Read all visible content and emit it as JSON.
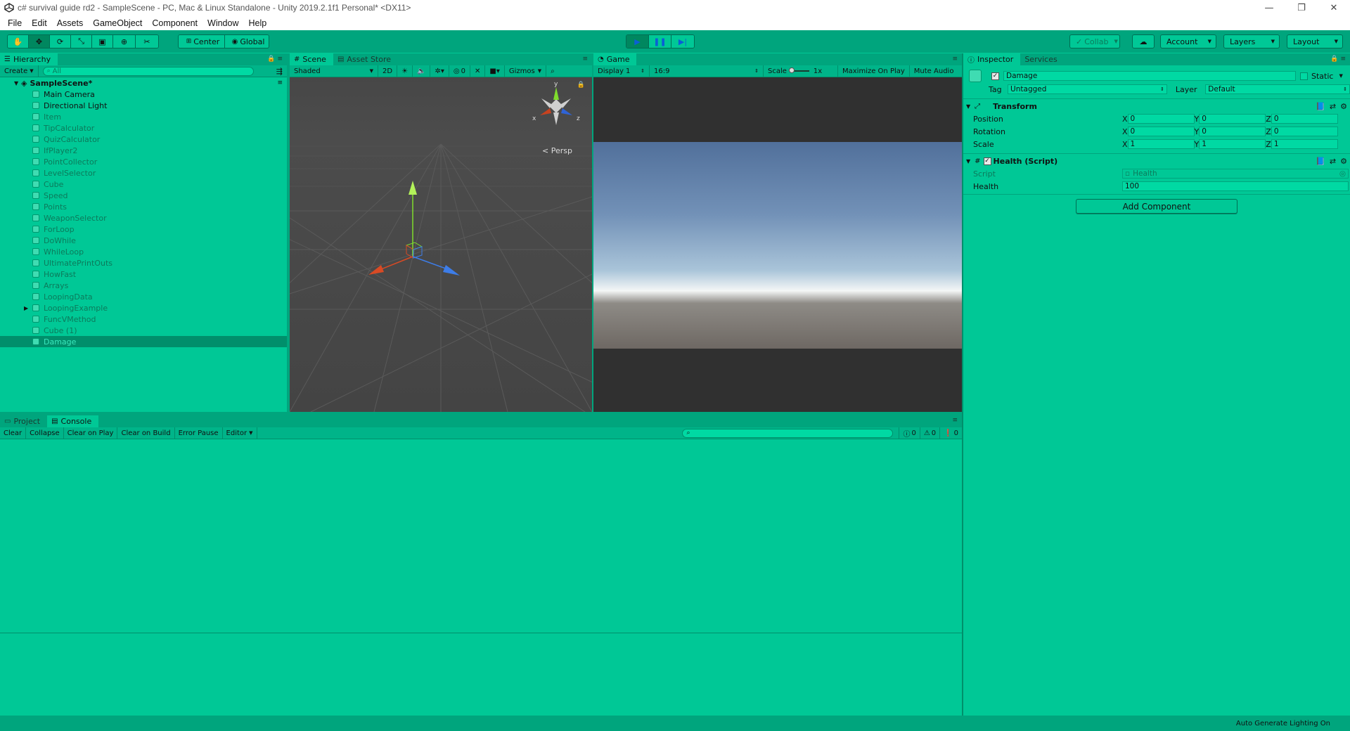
{
  "window": {
    "title": "c# survival guide rd2 - SampleScene - PC, Mac & Linux Standalone - Unity 2019.2.1f1 Personal* <DX11>",
    "controls": [
      "—",
      "❐",
      "✕"
    ]
  },
  "menu": [
    "File",
    "Edit",
    "Assets",
    "GameObject",
    "Component",
    "Window",
    "Help"
  ],
  "toolbar": {
    "pivot": "Center",
    "space": "Global",
    "collab": "Collab",
    "account": "Account",
    "layers": "Layers",
    "layout": "Layout"
  },
  "hierarchy": {
    "tab": "Hierarchy",
    "create": "Create",
    "search_placeholder": "All",
    "scene": "SampleScene*",
    "items": [
      {
        "label": "Main Camera"
      },
      {
        "label": "Directional Light"
      },
      {
        "label": "Item"
      },
      {
        "label": "TipCalculator"
      },
      {
        "label": "QuizCalculator"
      },
      {
        "label": "IfPlayer2"
      },
      {
        "label": "PointCollector"
      },
      {
        "label": "LevelSelector"
      },
      {
        "label": "Cube"
      },
      {
        "label": "Speed"
      },
      {
        "label": "Points"
      },
      {
        "label": "WeaponSelector"
      },
      {
        "label": "ForLoop"
      },
      {
        "label": "DoWhile"
      },
      {
        "label": "WhileLoop"
      },
      {
        "label": "UltimatePrintOuts"
      },
      {
        "label": "HowFast"
      },
      {
        "label": "Arrays"
      },
      {
        "label": "LoopingData"
      },
      {
        "label": "LoopingExample"
      },
      {
        "label": "FuncVMethod"
      },
      {
        "label": "Cube (1)"
      },
      {
        "label": "Damage"
      }
    ]
  },
  "scene": {
    "tabs": [
      "Scene",
      "Asset Store"
    ],
    "shading": "Shaded",
    "mode_2d": "2D",
    "fx_count": "0",
    "gizmos": "Gizmos",
    "persp": "Persp",
    "gizmo_axes": {
      "y": "y",
      "x": "x",
      "z": "z"
    }
  },
  "game": {
    "tab": "Game",
    "display": "Display 1",
    "aspect": "16:9",
    "scale_label": "Scale",
    "scale_value": "1x",
    "maximize": "Maximize On Play",
    "mute": "Mute Audio"
  },
  "inspector": {
    "tabs": [
      "Inspector",
      "Services"
    ],
    "object_name": "Damage",
    "static": "Static",
    "tag_label": "Tag",
    "tag_value": "Untagged",
    "layer_label": "Layer",
    "layer_value": "Default",
    "transform": {
      "title": "Transform",
      "rows": [
        {
          "label": "Position",
          "x": "0",
          "y": "0",
          "z": "0"
        },
        {
          "label": "Rotation",
          "x": "0",
          "y": "0",
          "z": "0"
        },
        {
          "label": "Scale",
          "x": "1",
          "y": "1",
          "z": "1"
        }
      ],
      "axis_labels": [
        "X",
        "Y",
        "Z"
      ]
    },
    "health_script": {
      "title": "Health (Script)",
      "script_label": "Script",
      "script_value": "Health",
      "health_label": "Health",
      "health_value": "100"
    },
    "add_component": "Add Component"
  },
  "console": {
    "tabs": [
      "Project",
      "Console"
    ],
    "buttons": [
      "Clear",
      "Collapse",
      "Clear on Play",
      "Clear on Build",
      "Error Pause",
      "Editor"
    ],
    "counts": {
      "log": "0",
      "warn": "0",
      "error": "0"
    }
  },
  "status": {
    "text": "Auto Generate Lighting On"
  },
  "colors": {
    "panel": "#00c896",
    "toolbar": "#00a57d",
    "selection": "#008f6b"
  }
}
